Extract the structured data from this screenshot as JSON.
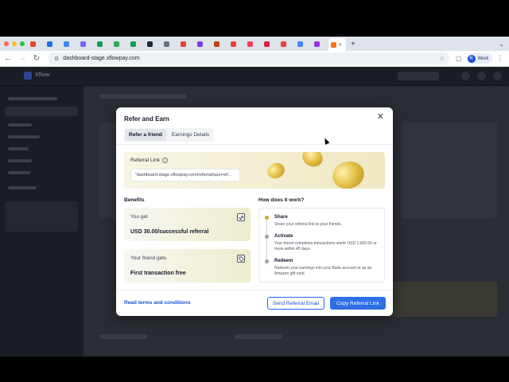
{
  "browser": {
    "tab_colors": [
      "#ea4335",
      "#1a73e8",
      "#4285f4",
      "#7b61ff",
      "#0f9d58",
      "#34a853",
      "#0f9d58",
      "#1f2937",
      "#6b7280",
      "#ea4335",
      "#7c3aed",
      "#c2410c",
      "#ea4335",
      "#f43f5e",
      "#e11d48",
      "#ea4335",
      "#4285f4",
      "#9333ea",
      "#f97316"
    ],
    "new_tab_glyph": "+",
    "menu_glyph": "⌄",
    "url": "dashboard-stage.xflowpay.com",
    "profile_initial": "R",
    "profile_label": "Work"
  },
  "app": {
    "brand": "Xflow"
  },
  "modal": {
    "title": "Refer and Earn",
    "close_glyph": "✕",
    "tabs": [
      {
        "label": "Refer a friend",
        "active": true
      },
      {
        "label": "Earnings Details",
        "active": false
      }
    ],
    "referral": {
      "label": "Referral Link",
      "value": "\"dashboard-stage.xflowpay.com/referral/ops+ref..."
    },
    "benefits": {
      "heading": "Benefits",
      "you_get_label": "You get",
      "you_get_value": "USD 30.00/successful referral",
      "friend_label": "Your friend gets",
      "friend_value": "First transaction free"
    },
    "how": {
      "heading": "How does it work?",
      "steps": [
        {
          "title": "Share",
          "desc": "Share your referral link to your friends."
        },
        {
          "title": "Activate",
          "desc": "Your friend completes transactions worth USD 1,000.00 or more within 45 days."
        },
        {
          "title": "Redeem",
          "desc": "Redeem your earnings into your Bank account or as an Amazon gift card."
        }
      ]
    },
    "terms_link": "Read terms and conditions",
    "send_button": "Send Referral Email",
    "copy_button": "Copy Referral Link"
  }
}
